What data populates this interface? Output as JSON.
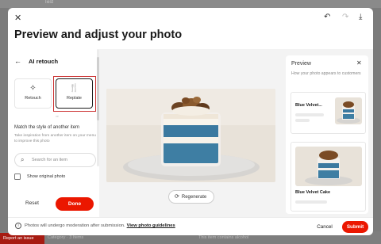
{
  "background": {
    "tab_label": "Test",
    "bottom_text": "Category · 3 Items",
    "bottom_text_right": "This item contains alcohol",
    "report_label": "Report an issue"
  },
  "header": {
    "title": "Preview and adjust your photo"
  },
  "left_panel": {
    "title": "AI retouch",
    "tools": [
      {
        "label": "Retouch",
        "icon": "sparkle-icon"
      },
      {
        "label": "Replate",
        "icon": "utensils-icon"
      }
    ],
    "separator": "or",
    "match_title": "Match the style of another item",
    "match_subtitle": "Take inspiration from another item on your menu to improve this photo",
    "search_placeholder": "Search for an item",
    "show_original_label": "Show original photo",
    "reset_label": "Reset",
    "done_label": "Done"
  },
  "center": {
    "regenerate_label": "Regenerate"
  },
  "preview": {
    "title": "Preview",
    "subtitle": "How your photo appears to customers",
    "item_name_1": "Blue Velvet...",
    "item_name_2": "Blue Velvet Cake"
  },
  "footer": {
    "notice": "Photos will undergo moderation after submission.",
    "link": "View photo guidelines",
    "cancel_label": "Cancel",
    "submit_label": "Submit"
  },
  "colors": {
    "accent": "#eb1700",
    "text": "#191919"
  }
}
